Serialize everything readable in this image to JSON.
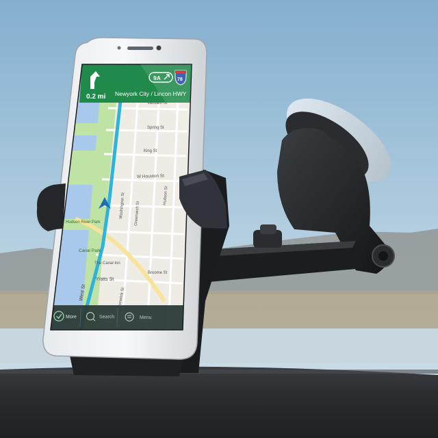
{
  "navigation": {
    "distance": "0.2 mi",
    "street": "Newyork City / Lincon HWY",
    "exit_badge": "9A",
    "route_shield": "78"
  },
  "map_labels": {
    "w_houston": "W Houston St",
    "king": "King St",
    "vandam": "Vandam St",
    "spring": "Spring St",
    "broome": "Broome St",
    "watts": "Watts St",
    "canal_park": "Canal Park",
    "canal_inn": "The Canal Inn",
    "hudson_river_park": "Hudson River Park",
    "west_st": "West St",
    "washington": "Washington St",
    "greenwich": "Greenwich St",
    "hudson": "Hudson St",
    "renwick": "Renwick St"
  },
  "bottom_bar": {
    "more": "More",
    "search": "Search",
    "menu": "Menu"
  },
  "icons": {
    "turn": "turn-arrow-icon",
    "exit": "exit-arrow-icon",
    "shield": "interstate-shield-icon",
    "check": "check-icon",
    "search": "search-icon",
    "menu": "menu-icon",
    "position": "navigation-position-icon"
  },
  "colors": {
    "nav_header": "#1f8a4a",
    "route": "#2fb3d9",
    "park": "#bfe3a5",
    "water": "#a9c9ec",
    "sky_top": "#8fb6d3",
    "sky_bottom": "#c6d9e4",
    "dashboard": "#2b2d30",
    "mount": "#1f2123"
  }
}
